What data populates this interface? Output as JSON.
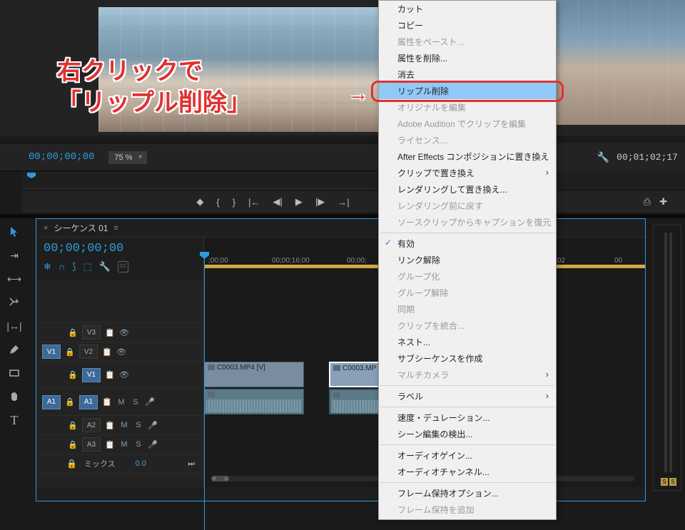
{
  "annotation": {
    "line1": "右クリックで",
    "line2": "「リップル削除」",
    "arrow": "→"
  },
  "source_timecode": "00;00;00;00",
  "zoom": "75 %",
  "program_timecode": "00;01;02;17",
  "sequence_tab": "シーケンス 01",
  "timeline_timecode": "00;00;00;00",
  "ruler_ticks": [
    ";00;00",
    "00;00;16;00",
    "00;00;",
    "02",
    "00"
  ],
  "tracks": {
    "v3": "V3",
    "v2": "V2",
    "v1_sel": "V1",
    "v1": "V1",
    "a1_sel": "A1",
    "a1": "A1",
    "a2": "A2",
    "a3": "A3"
  },
  "track_flags": {
    "m": "M",
    "s": "S"
  },
  "mix_label": "ミックス",
  "mix_value": "0.0",
  "clips": {
    "v1a": "C0003.MP4 [V]",
    "v1b": "C0003.MP"
  },
  "ctx": [
    {
      "t": "カット"
    },
    {
      "t": "コピー"
    },
    {
      "t": "属性をペースト...",
      "d": true
    },
    {
      "t": "属性を削除..."
    },
    {
      "t": "消去"
    },
    {
      "t": "リップル削除",
      "hl": true
    },
    {
      "t": "オリジナルを編集",
      "d": true
    },
    {
      "t": "Adobe Audition でクリップを編集",
      "d": true
    },
    {
      "t": "ライセンス...",
      "d": true
    },
    {
      "t": "After Effects コンポジションに置き換え"
    },
    {
      "t": "クリップで置き換え",
      "sub": true
    },
    {
      "t": "レンダリングして置き換え..."
    },
    {
      "t": "レンダリング前に戻す",
      "d": true
    },
    {
      "t": "ソースクリップからキャプションを復元",
      "d": true
    },
    {
      "sep": true
    },
    {
      "t": "有効",
      "chk": true
    },
    {
      "t": "リンク解除"
    },
    {
      "t": "グループ化",
      "d": true
    },
    {
      "t": "グループ解除",
      "d": true
    },
    {
      "t": "同期",
      "d": true
    },
    {
      "t": "クリップを統合...",
      "d": true
    },
    {
      "t": "ネスト..."
    },
    {
      "t": "サブシーケンスを作成"
    },
    {
      "t": "マルチカメラ",
      "d": true,
      "sub": true
    },
    {
      "sep": true
    },
    {
      "t": "ラベル",
      "sub": true
    },
    {
      "sep": true
    },
    {
      "t": "速度・デュレーション..."
    },
    {
      "t": "シーン編集の検出..."
    },
    {
      "sep": true
    },
    {
      "t": "オーディオゲイン..."
    },
    {
      "t": "オーディオチャンネル..."
    },
    {
      "sep": true
    },
    {
      "t": "フレーム保持オプション..."
    },
    {
      "t": "フレーム保持を追加",
      "d": true
    }
  ],
  "meter_s": "S"
}
